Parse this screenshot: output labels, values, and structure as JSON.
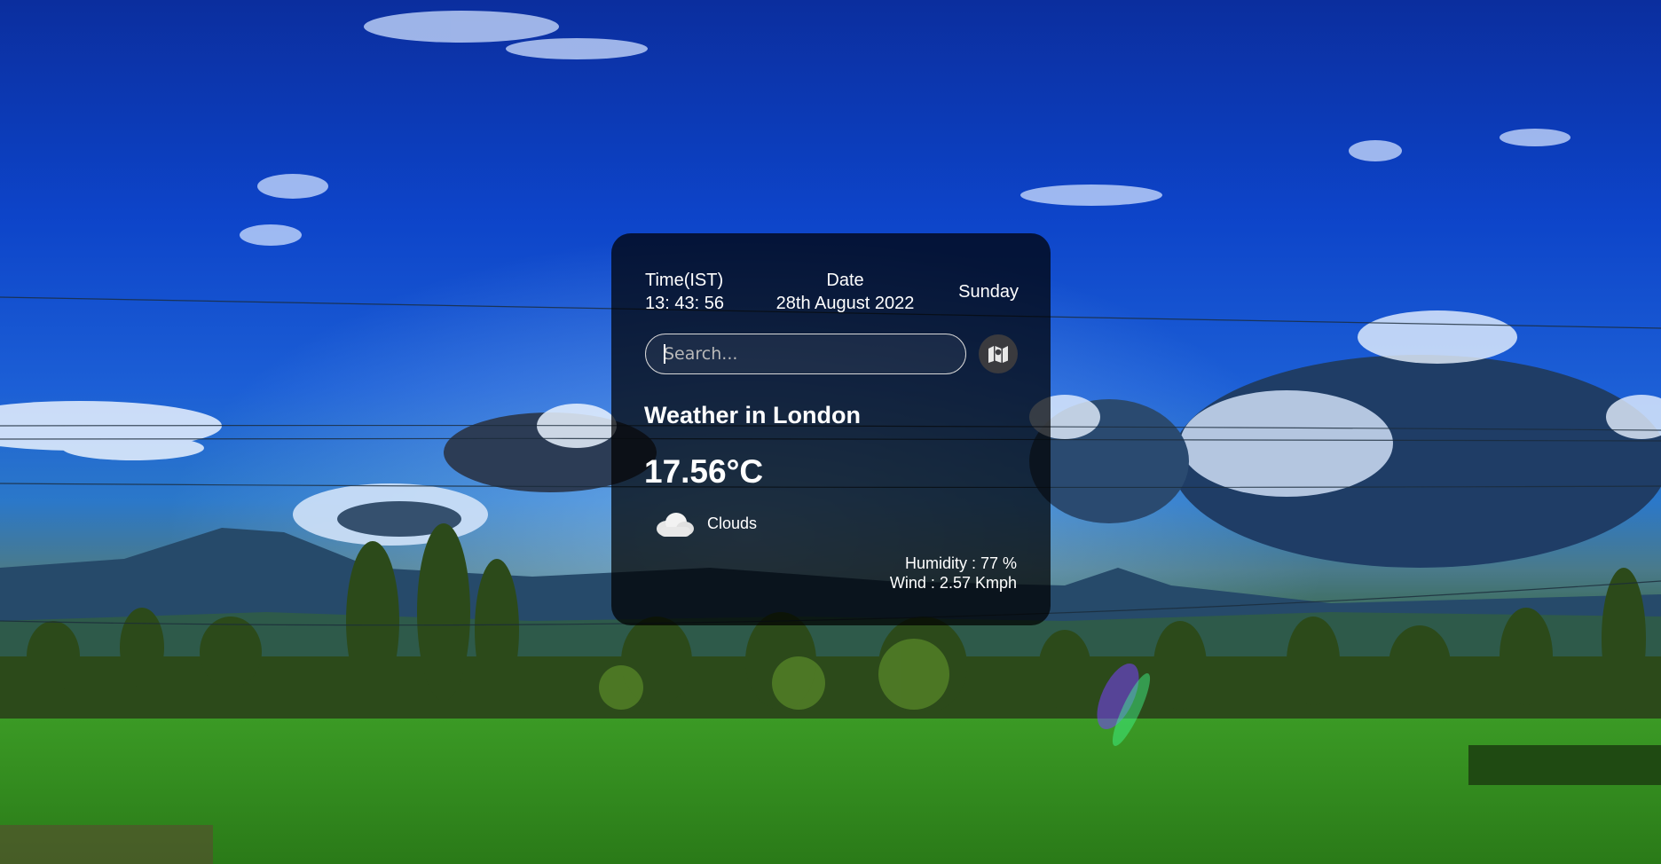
{
  "header": {
    "time_label": "Time(IST)",
    "time_value": "13: 43: 56",
    "date_label": "Date",
    "date_value": "28th August 2022",
    "day": "Sunday"
  },
  "search": {
    "placeholder": "Search...",
    "value": ""
  },
  "map_button": {
    "icon": "map-icon"
  },
  "weather": {
    "title": "Weather in London",
    "temperature": "17.56°C",
    "condition": "Clouds",
    "condition_icon": "cloud-icon",
    "humidity": "Humidity : 77 %",
    "wind": "Wind : 2.57 Kmph"
  },
  "colors": {
    "card_bg": "rgba(0,0,0,0.72)",
    "text": "#ffffff",
    "map_button_bg": "#3a3a3e"
  }
}
